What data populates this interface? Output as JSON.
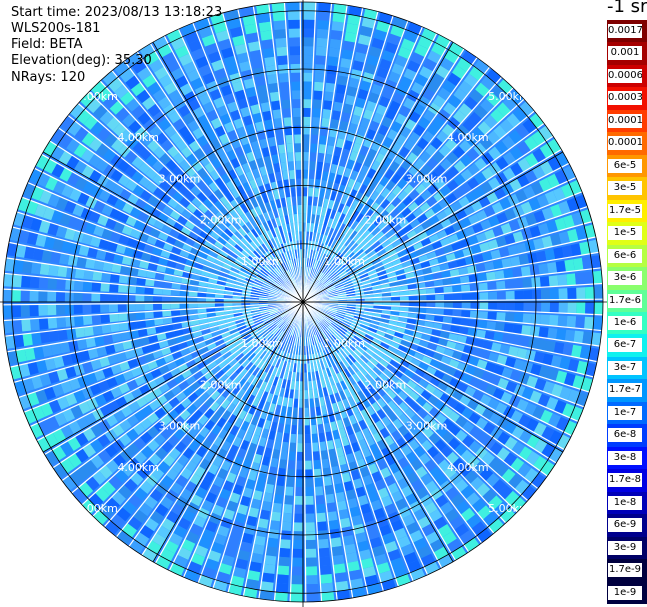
{
  "header": {
    "start_time": "Start time: 2023/08/13 13:18:23",
    "instrument": "WLS200s-181",
    "field": "Field: BETA",
    "elevation": "Elevation(deg): 35.30",
    "nrays": "NRays: 120"
  },
  "chart_data": {
    "type": "heatmap",
    "projection": "polar (PPI scan)",
    "field": "BETA",
    "nrays": 120,
    "range_rings": [
      {
        "value": 1.0,
        "label": "1.00km"
      },
      {
        "value": 2.0,
        "label": "2.00km"
      },
      {
        "value": 3.0,
        "label": "3.00km"
      },
      {
        "value": 4.0,
        "label": "4.00km"
      },
      {
        "value": 5.0,
        "label": "5.00km"
      }
    ],
    "max_range_km": 5.15,
    "dominant_value_range": [
      "1.7e-8",
      "1e-7"
    ],
    "colorbar": {
      "title": "-1 sr",
      "ticks": [
        "0.0017",
        "0.001",
        "0.0006",
        "0.0003",
        "0.00017",
        "0.0001",
        "6e-5",
        "3e-5",
        "1.7e-5",
        "1e-5",
        "6e-6",
        "3e-6",
        "1.7e-6",
        "1e-6",
        "6e-7",
        "3e-7",
        "1.7e-7",
        "1e-7",
        "6e-8",
        "3e-8",
        "1.7e-8",
        "1e-8",
        "6e-9",
        "3e-9",
        "1.7e-9",
        "1e-9"
      ],
      "colors": [
        "#7f0000",
        "#a50000",
        "#cc0000",
        "#f21000",
        "#ff3d00",
        "#ff6a00",
        "#ff9700",
        "#ffc400",
        "#ffee00",
        "#e0ff17",
        "#b5ff42",
        "#8aff6d",
        "#5fff98",
        "#34ffc3",
        "#0ff1ef",
        "#00c4ff",
        "#0097ff",
        "#006aff",
        "#003dff",
        "#0010ff",
        "#0000e3",
        "#0000b8",
        "#00008d",
        "#000066",
        "#00003f"
      ]
    }
  }
}
